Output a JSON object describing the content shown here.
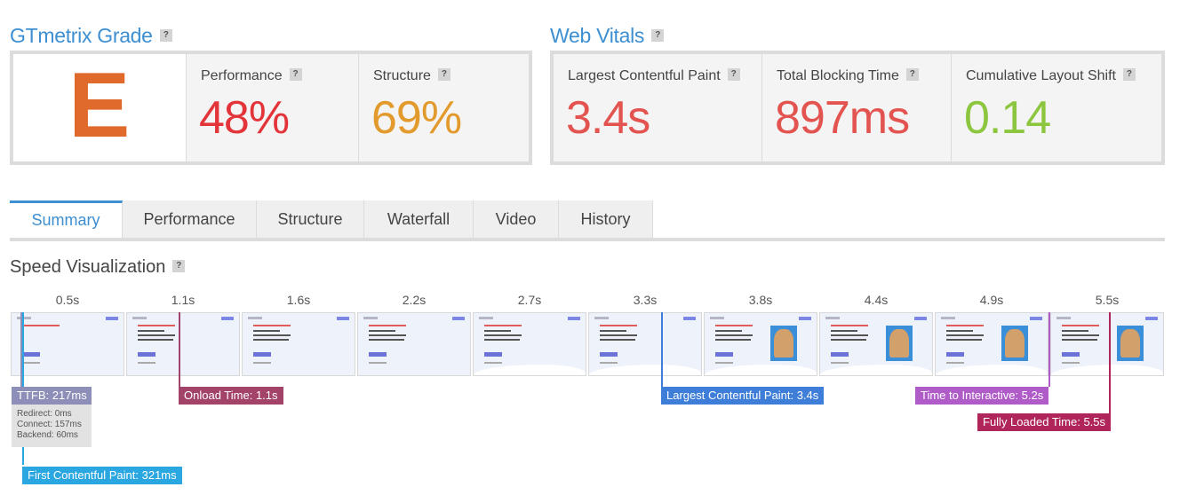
{
  "grade_section": {
    "title": "GTmetrix Grade",
    "help": "?"
  },
  "grade": {
    "letter": "E",
    "color": "#e06a2c"
  },
  "performance": {
    "label": "Performance",
    "value": "48%",
    "color": "#e3343a"
  },
  "structure": {
    "label": "Structure",
    "value": "69%",
    "color": "#e29a2c"
  },
  "vitals_section": {
    "title": "Web Vitals",
    "help": "?"
  },
  "lcp": {
    "label": "Largest Contentful Paint",
    "value": "3.4s",
    "color": "#e3534f"
  },
  "tbt": {
    "label": "Total Blocking Time",
    "value": "897ms",
    "color": "#e3534f"
  },
  "cls": {
    "label": "Cumulative Layout Shift",
    "value": "0.14",
    "color": "#8cc63e"
  },
  "tabs": [
    {
      "label": "Summary",
      "active": true
    },
    {
      "label": "Performance",
      "active": false
    },
    {
      "label": "Structure",
      "active": false
    },
    {
      "label": "Waterfall",
      "active": false
    },
    {
      "label": "Video",
      "active": false
    },
    {
      "label": "History",
      "active": false
    }
  ],
  "speed_visualization": {
    "title": "Speed Visualization",
    "times": [
      "0.5s",
      "1.1s",
      "1.6s",
      "2.2s",
      "2.7s",
      "3.3s",
      "3.8s",
      "4.4s",
      "4.9s",
      "5.5s"
    ],
    "markers": {
      "ttfb": {
        "label": "TTFB: 217ms",
        "color": "#8d8fb8"
      },
      "ttfb_details": [
        "Redirect: 0ms",
        "Connect: 157ms",
        "Backend: 60ms"
      ],
      "fcp": {
        "label": "First Contentful Paint: 321ms",
        "color": "#2aa6e0"
      },
      "onload": {
        "label": "Onload Time: 1.1s",
        "color": "#a4436a"
      },
      "lcp": {
        "label": "Largest Contentful Paint: 3.4s",
        "color": "#3e7ed8"
      },
      "tti": {
        "label": "Time to Interactive: 5.2s",
        "color": "#b05cc8"
      },
      "flt": {
        "label": "Fully Loaded Time: 5.5s",
        "color": "#b0265a"
      }
    }
  }
}
